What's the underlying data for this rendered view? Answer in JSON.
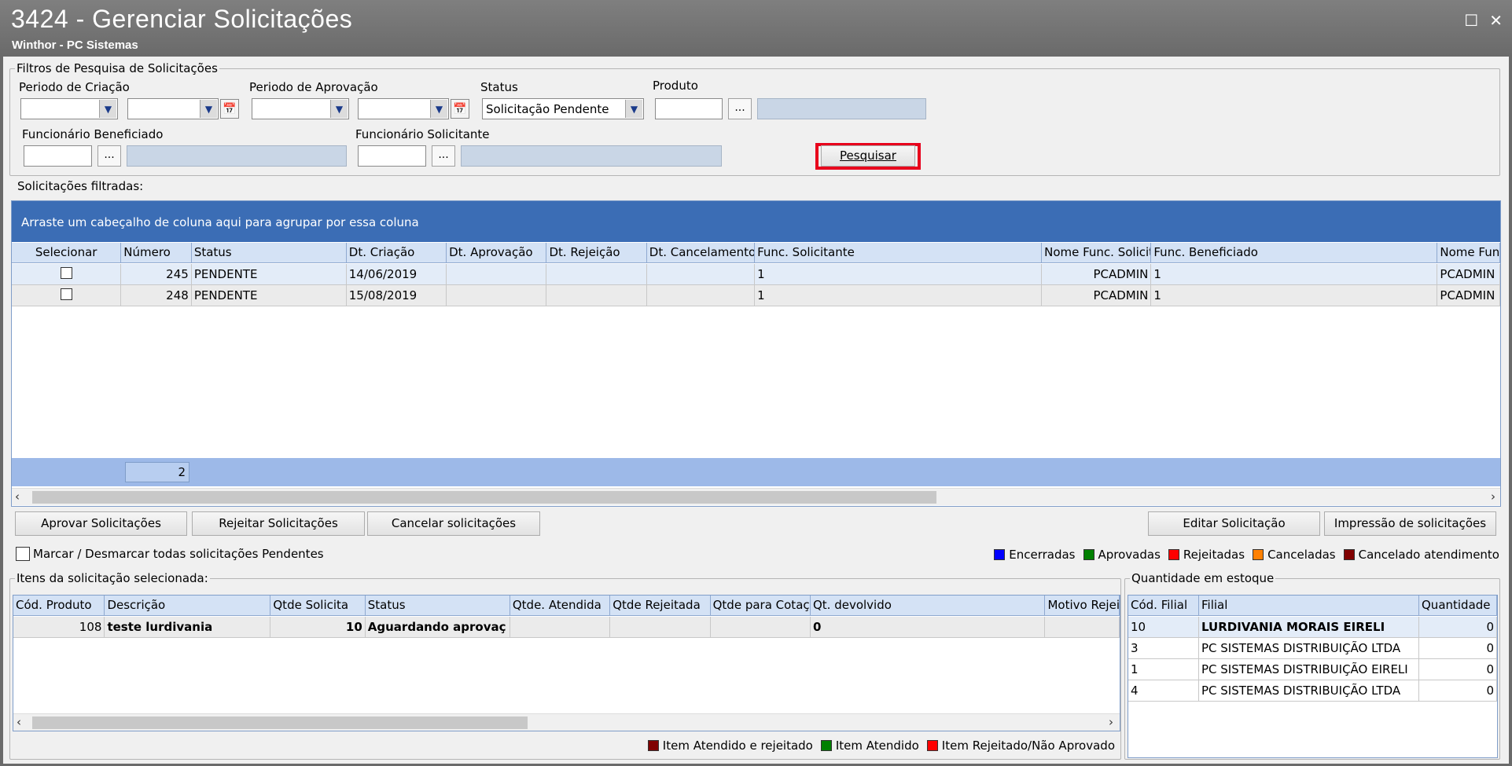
{
  "window": {
    "title": "3424 - Gerenciar Solicitações",
    "subtitle": "Winthor - PC Sistemas",
    "maximize_glyph": "☐",
    "close_glyph": "✕"
  },
  "filters": {
    "legend": "Filtros de Pesquisa de Solicitações",
    "periodo_criacao_label": "Periodo de Criação",
    "periodo_aprovacao_label": "Periodo de Aprovação",
    "status_label": "Status",
    "status_value": "Solicitação Pendente",
    "produto_label": "Produto",
    "func_beneficiado_label": "Funcionário Beneficiado",
    "func_solicitante_label": "Funcionário Solicitante",
    "dots": "...",
    "search_button": "Pesquisar",
    "highlight_color": "#e8001c"
  },
  "requests": {
    "section_label": "Solicitações filtradas:",
    "group_hint": "Arraste um cabeçalho de coluna aqui para agrupar por essa coluna",
    "columns": [
      "Selecionar",
      "Número",
      "Status",
      "Dt. Criação",
      "Dt. Aprovação",
      "Dt. Rejeição",
      "Dt. Cancelamento",
      "Func. Solicitante",
      "Nome Func. Solicit",
      "Func. Beneficiado",
      "Nome Fun"
    ],
    "rows": [
      {
        "numero": "245",
        "status": "PENDENTE",
        "dt_criacao": "14/06/2019",
        "dt_aprovacao": "",
        "dt_rejeicao": "",
        "dt_cancelamento": "",
        "func_solicitante": "1",
        "nome_func_solicit": "PCADMIN",
        "func_beneficiado": "1",
        "nome_fun": "PCADMIN"
      },
      {
        "numero": "248",
        "status": "PENDENTE",
        "dt_criacao": "15/08/2019",
        "dt_aprovacao": "",
        "dt_rejeicao": "",
        "dt_cancelamento": "",
        "func_solicitante": "1",
        "nome_func_solicit": "PCADMIN",
        "func_beneficiado": "1",
        "nome_fun": "PCADMIN"
      }
    ],
    "footer_count": "2"
  },
  "actions": {
    "aprovar": "Aprovar Solicitações",
    "rejeitar": "Rejeitar Solicitações",
    "cancelar": "Cancelar solicitações",
    "editar": "Editar Solicitação",
    "impressao": "Impressão de solicitações",
    "marcar": "Marcar / Desmarcar todas solicitações Pendentes"
  },
  "legend_top": [
    {
      "label": "Encerradas",
      "color": "#0000ff"
    },
    {
      "label": "Aprovadas",
      "color": "#008000"
    },
    {
      "label": "Rejeitadas",
      "color": "#ff0000"
    },
    {
      "label": "Canceladas",
      "color": "#ff8000"
    },
    {
      "label": "Cancelado atendimento",
      "color": "#800000"
    }
  ],
  "items": {
    "legend": "Itens da solicitação selecionada:",
    "columns": [
      "Cód. Produto",
      "Descrição",
      "Qtde Solicita",
      "Status",
      "Qtde. Atendida",
      "Qtde Rejeitada",
      "Qtde para Cotaç",
      "Qt. devolvido",
      "Motivo Rejei"
    ],
    "rows": [
      {
        "cod": "108",
        "descricao": "teste lurdivania",
        "qtde_solicitada": "10",
        "status": "Aguardando aprovaç",
        "qtde_atendida": "",
        "qtde_rejeitada": "",
        "qtde_cotacao": "",
        "qt_devolvido": "0",
        "motivo": ""
      }
    ]
  },
  "legend_bottom": [
    {
      "label": "Item Atendido e rejeitado",
      "color": "#800000"
    },
    {
      "label": "Item Atendido",
      "color": "#008000"
    },
    {
      "label": "Item Rejeitado/Não Aprovado",
      "color": "#ff0000"
    }
  ],
  "stock": {
    "legend": "Quantidade em estoque",
    "columns": [
      "Cód. Filial",
      "Filial",
      "Quantidade"
    ],
    "rows": [
      {
        "cod": "10",
        "filial": "LURDIVANIA MORAIS  EIRELI",
        "qtd": "0"
      },
      {
        "cod": "3",
        "filial": "PC SISTEMAS DISTRIBUIÇÃO LTDA",
        "qtd": "0"
      },
      {
        "cod": "1",
        "filial": "PC SISTEMAS DISTRIBUIÇÃO  EIRELI",
        "qtd": "0"
      },
      {
        "cod": "4",
        "filial": "PC SISTEMAS DISTRIBUIÇÃO LTDA",
        "qtd": "0"
      }
    ]
  }
}
